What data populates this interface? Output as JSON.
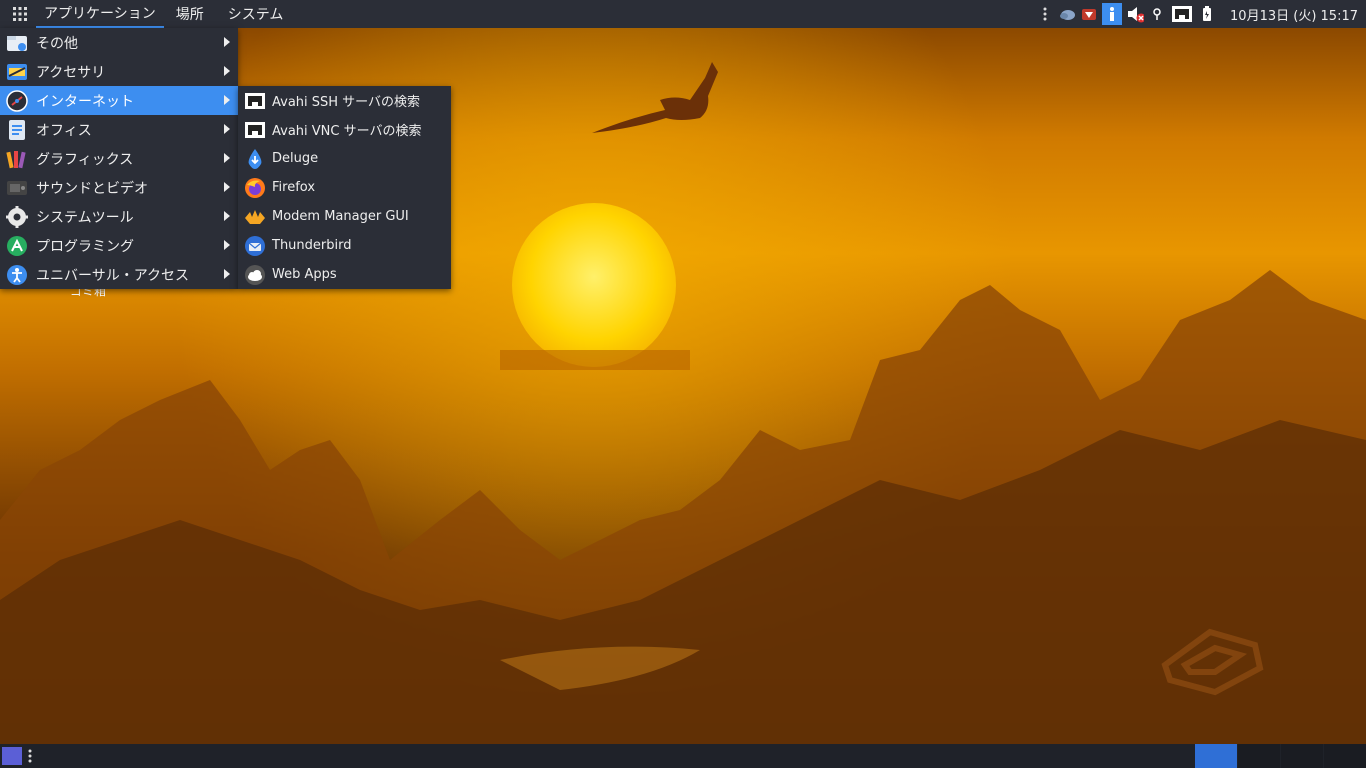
{
  "topbar": {
    "menus": [
      "アプリケーション",
      "場所",
      "システム"
    ],
    "clock": "10月13日 (火) 15:17"
  },
  "main_menu": [
    {
      "label": "その他",
      "icon": "folder-icon"
    },
    {
      "label": "アクセサリ",
      "icon": "accessories-icon"
    },
    {
      "label": "インターネット",
      "icon": "internet-icon"
    },
    {
      "label": "オフィス",
      "icon": "office-icon"
    },
    {
      "label": "グラフィックス",
      "icon": "graphics-icon"
    },
    {
      "label": "サウンドとビデオ",
      "icon": "sound-video-icon"
    },
    {
      "label": "システムツール",
      "icon": "gear-icon"
    },
    {
      "label": "プログラミング",
      "icon": "programming-icon"
    },
    {
      "label": "ユニバーサル・アクセス",
      "icon": "accessibility-icon"
    }
  ],
  "submenu": [
    {
      "label": "Avahi SSH サーバの検索",
      "icon": "network-icon"
    },
    {
      "label": "Avahi VNC サーバの検索",
      "icon": "network-icon"
    },
    {
      "label": "Deluge",
      "icon": "deluge-icon"
    },
    {
      "label": "Firefox",
      "icon": "firefox-icon"
    },
    {
      "label": "Modem Manager GUI",
      "icon": "modem-icon"
    },
    {
      "label": "Thunderbird",
      "icon": "thunderbird-icon"
    },
    {
      "label": "Web Apps",
      "icon": "web-apps-icon"
    }
  ],
  "desktop": {
    "icon_label_partial": "ゴミ箱"
  },
  "colors": {
    "accent": "#3d8ef0",
    "panel": "#2b2e37"
  }
}
